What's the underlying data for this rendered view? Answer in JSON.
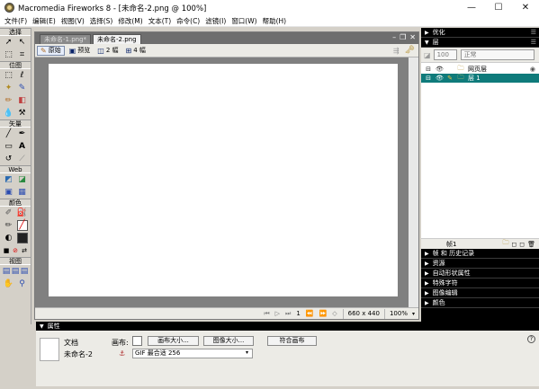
{
  "window": {
    "title": "Macromedia Fireworks 8 - [未命名-2.png @ 100%]",
    "minimize": "—",
    "maximize": "☐",
    "close": "✕"
  },
  "menu": [
    "文件(F)",
    "编辑(E)",
    "视图(V)",
    "选择(S)",
    "修改(M)",
    "文本(T)",
    "命令(C)",
    "滤镜(I)",
    "窗口(W)",
    "帮助(H)"
  ],
  "toolbox": {
    "select": "选择",
    "bitmap": "位图",
    "vector": "矢量",
    "web": "Web",
    "colors": "颜色",
    "view": "视图"
  },
  "document": {
    "tabs": [
      "未命名-1.png*",
      "未命名-2.png"
    ],
    "active_tab": 1,
    "view_buttons": [
      "原始",
      "预览",
      "2 幅",
      "4 幅"
    ],
    "frame_number": "1",
    "canvas_size": "660 x 440",
    "zoom": "100%",
    "ctrl_min": "–",
    "ctrl_restore": "❐",
    "ctrl_close": "✕"
  },
  "panels": {
    "optimize": "优化",
    "layers": "层",
    "opacity": "100",
    "blend_mode": "正常",
    "layer_rows": [
      {
        "name": "网页层",
        "selected": false
      },
      {
        "name": "层 1",
        "selected": true
      }
    ],
    "frame_label": "帧1",
    "collapsed": [
      "帧 和 历史记录",
      "资源",
      "自动形状属性",
      "特殊字符",
      "图像编辑",
      "颜色"
    ]
  },
  "properties": {
    "header": "属性",
    "doc_label": "文档",
    "doc_name": "未命名-2",
    "canvas_label": "画布:",
    "canvas_size_btn": "画布大小...",
    "image_size_btn": "图像大小...",
    "fit_canvas_btn": "符合画布",
    "optimize_setting": "GIF 最合适 256",
    "help_icon": "?"
  },
  "colors": {
    "selected_layer": "#0f7b7b",
    "panel_bg": "#000000",
    "canvas_bg": "#808080"
  }
}
